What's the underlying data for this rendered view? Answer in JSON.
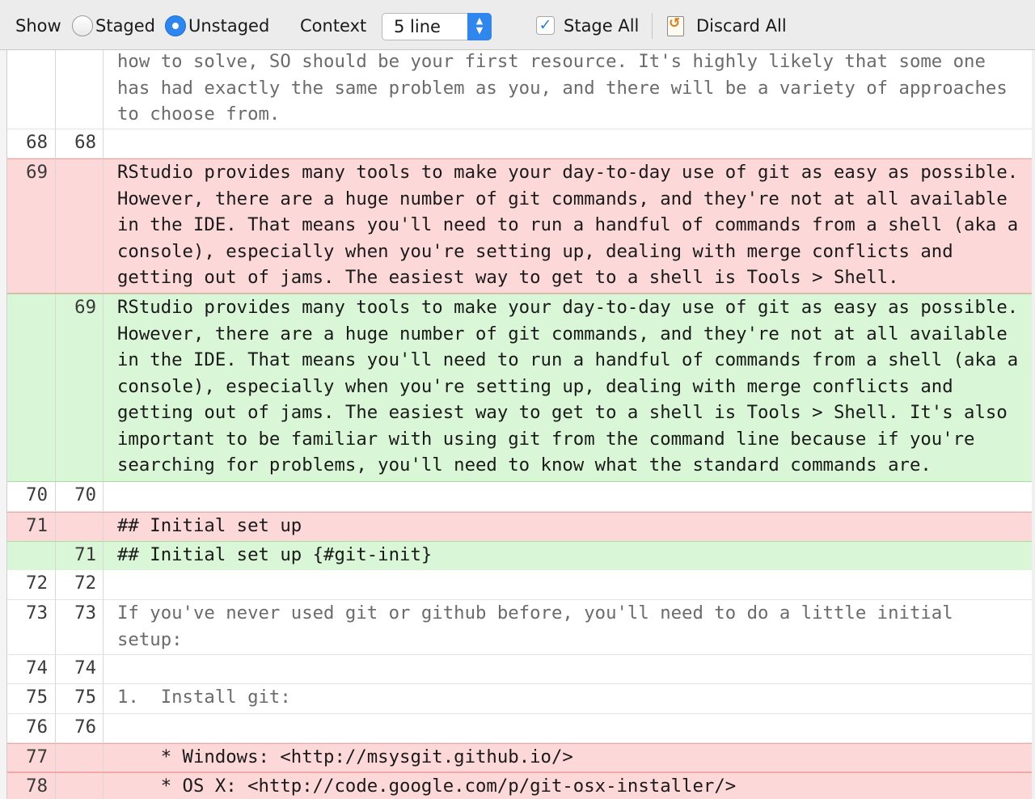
{
  "toolbar": {
    "show_label": "Show",
    "staged_label": "Staged",
    "unstaged_label": "Unstaged",
    "selected_view": "Unstaged",
    "context_label": "Context",
    "context_value": "5 line",
    "stage_all_label": "Stage All",
    "stage_all_checked": true,
    "discard_all_label": "Discard All"
  },
  "diff_rows": [
    {
      "type": "ctx",
      "old": "",
      "new": "",
      "text": "how to solve, SO should be your first resource. It's highly likely that some one has had exactly the same problem as you, and there will be a variety of approaches to choose from."
    },
    {
      "type": "ctx",
      "old": "68",
      "new": "68",
      "text": ""
    },
    {
      "type": "del",
      "old": "69",
      "new": "",
      "text": "RStudio provides many tools to make your day-to-day use of git as easy as possible. However, there are a huge number of git commands, and they're not at all available in the IDE. That means you'll need to run a handful of commands from a shell (aka a console), especially when you're setting up, dealing with merge conflicts and getting out of jams. The easiest way to get to a shell is Tools > Shell."
    },
    {
      "type": "add",
      "old": "",
      "new": "69",
      "text": "RStudio provides many tools to make your day-to-day use of git as easy as possible. However, there are a huge number of git commands, and they're not at all available in the IDE. That means you'll need to run a handful of commands from a shell (aka a console), especially when you're setting up, dealing with merge conflicts and getting out of jams. The easiest way to get to a shell is Tools > Shell. It's also important to be familiar with using git from the command line because if you're searching for problems, you'll need to know what the standard commands are."
    },
    {
      "type": "ctx",
      "old": "70",
      "new": "70",
      "text": ""
    },
    {
      "type": "del",
      "old": "71",
      "new": "",
      "text": "## Initial set up"
    },
    {
      "type": "add",
      "old": "",
      "new": "71",
      "text": "## Initial set up {#git-init}"
    },
    {
      "type": "ctx",
      "old": "72",
      "new": "72",
      "text": ""
    },
    {
      "type": "ctx",
      "old": "73",
      "new": "73",
      "text": "If you've never used git or github before, you'll need to do a little initial setup:"
    },
    {
      "type": "ctx",
      "old": "74",
      "new": "74",
      "text": ""
    },
    {
      "type": "ctx",
      "old": "75",
      "new": "75",
      "text": "1.  Install git:"
    },
    {
      "type": "ctx",
      "old": "76",
      "new": "76",
      "text": ""
    },
    {
      "type": "del",
      "old": "77",
      "new": "",
      "text": "    * Windows: <http://msysgit.github.io/>"
    },
    {
      "type": "del",
      "old": "78",
      "new": "",
      "text": "    * OS X: <http://code.google.com/p/git-osx-installer/>"
    }
  ]
}
